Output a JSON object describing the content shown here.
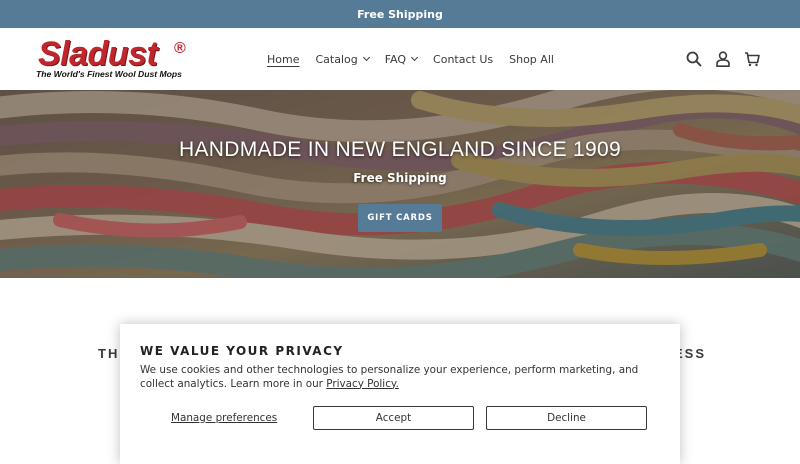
{
  "announcement": "Free Shipping",
  "logo": {
    "name": "Sladust",
    "registered": "®",
    "tagline": "The World's Finest Wool Dust Mops"
  },
  "nav": {
    "items": [
      {
        "label": "Home",
        "active": true,
        "dropdown": false
      },
      {
        "label": "Catalog",
        "active": false,
        "dropdown": true
      },
      {
        "label": "FAQ",
        "active": false,
        "dropdown": true
      },
      {
        "label": "Contact Us",
        "active": false,
        "dropdown": false
      },
      {
        "label": "Shop All",
        "active": false,
        "dropdown": false
      }
    ]
  },
  "header_icons": [
    "search-icon",
    "account-icon",
    "cart-icon"
  ],
  "hero": {
    "title": "HANDMADE IN NEW ENGLAND SINCE 1909",
    "subtitle": "Free Shipping",
    "button": "GIFT CARDS"
  },
  "section_heading_partial": {
    "left": "THI",
    "right": "ESS"
  },
  "cookie": {
    "title": "WE VALUE YOUR PRIVACY",
    "body": "We use cookies and other technologies to personalize your experience, perform marketing, and collect analytics. Learn more in our",
    "policy_link": "Privacy Policy.",
    "manage": "Manage preferences",
    "accept": "Accept",
    "decline": "Decline"
  },
  "colors": {
    "accent": "#557b97",
    "logo_red": "#c0272d"
  }
}
